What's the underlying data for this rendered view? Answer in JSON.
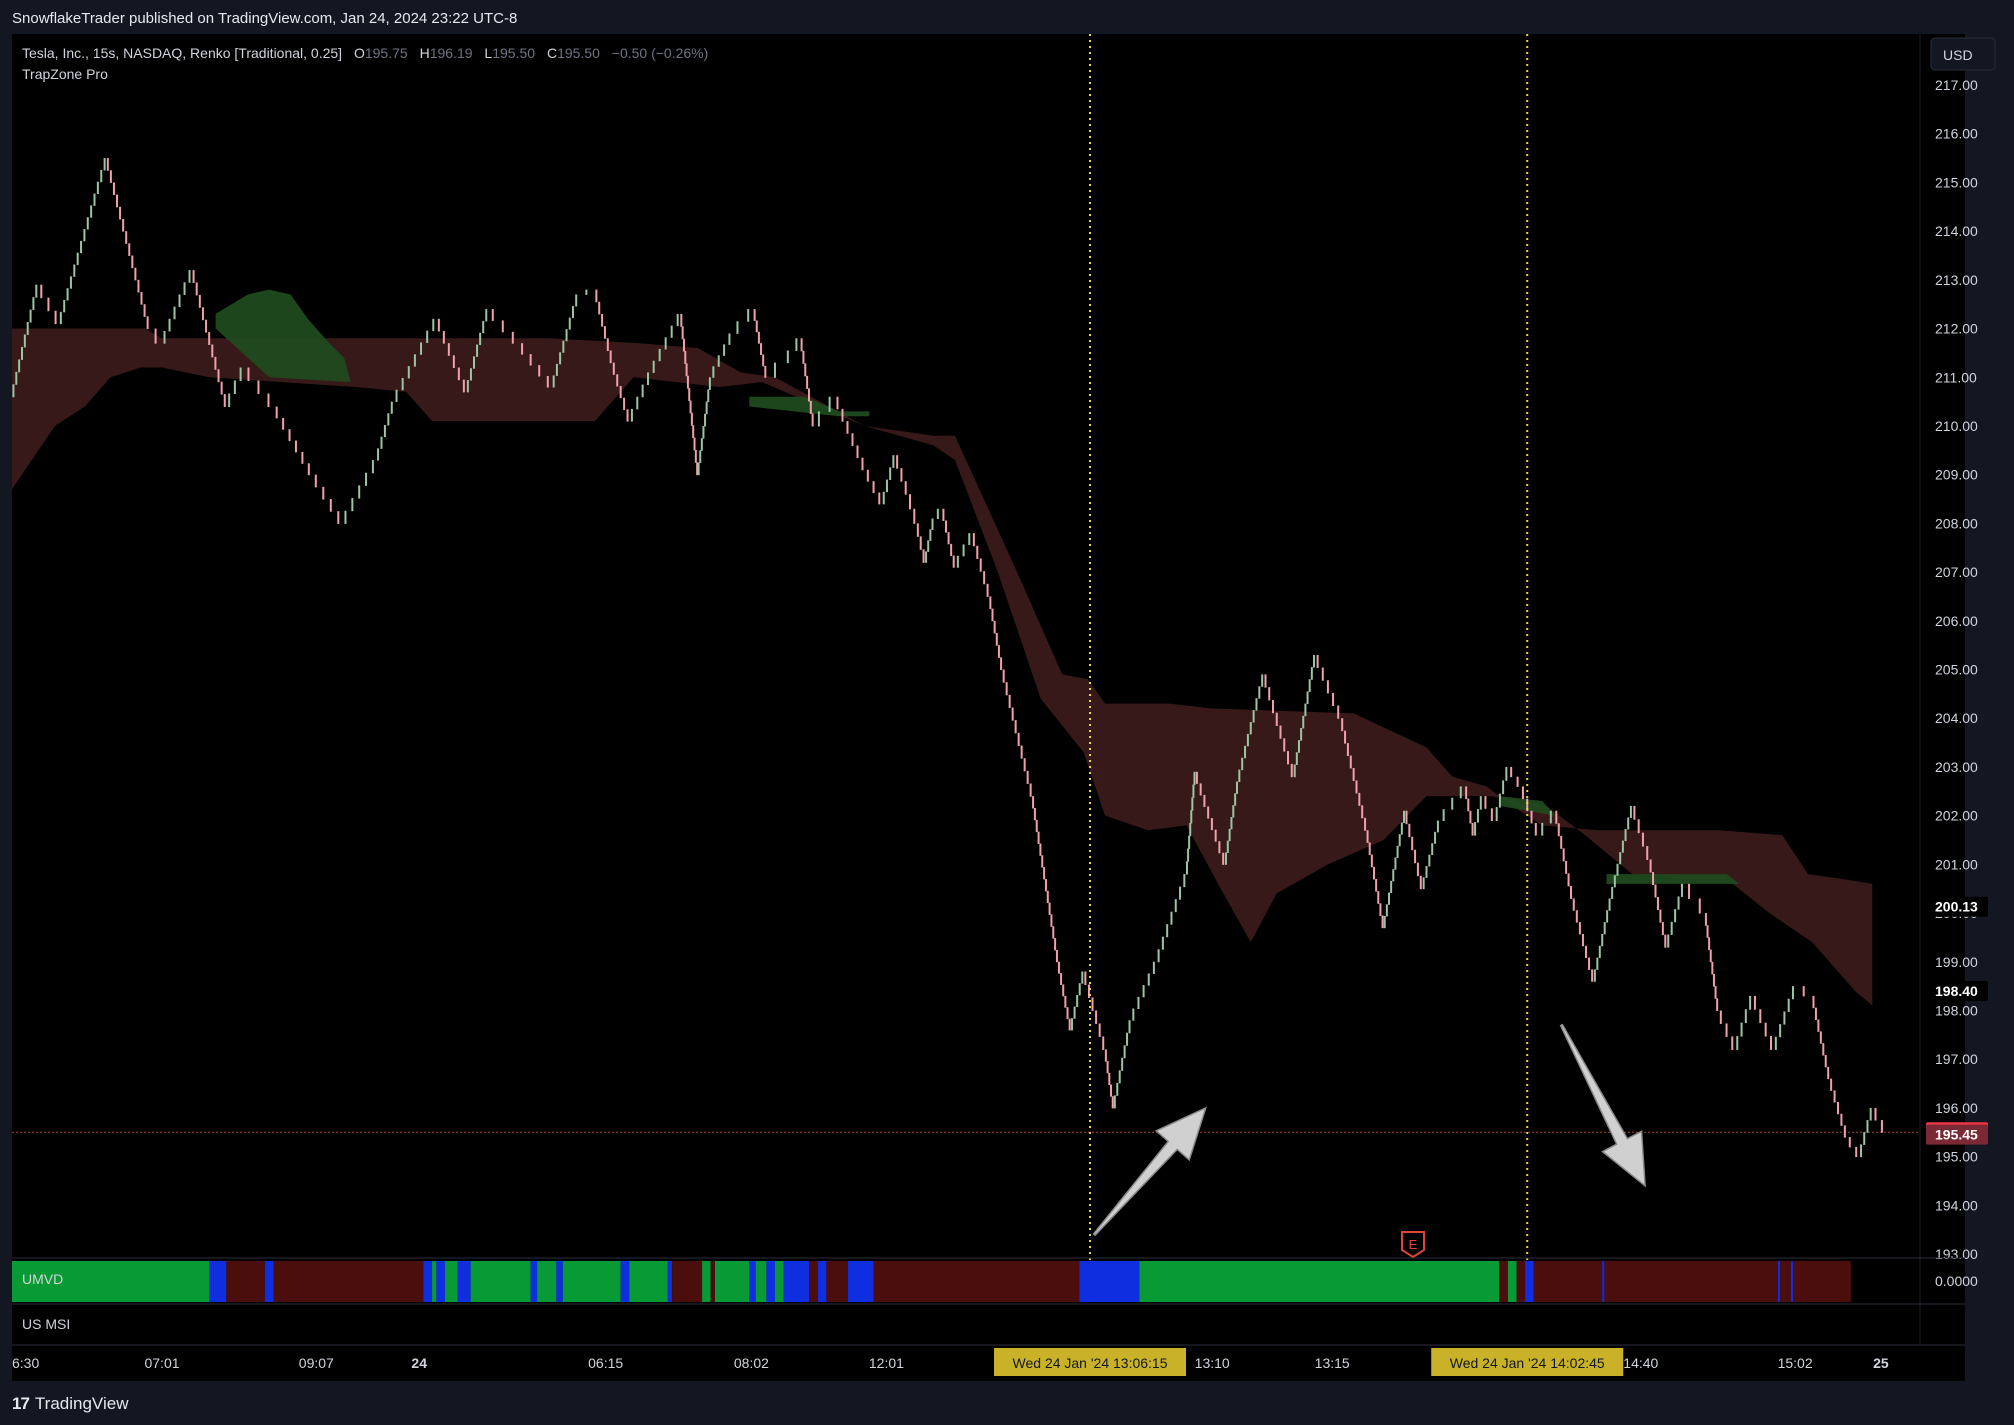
{
  "publisher": "SnowflakeTrader published on TradingView.com, Jan 24, 2024 23:22 UTC-8",
  "legend": {
    "symbol": "Tesla, Inc., 15s, NASDAQ, Renko [Traditional, 0.25]",
    "o_label": "O",
    "o_value": "195.75",
    "h_label": "H",
    "h_value": "196.19",
    "l_label": "L",
    "l_value": "195.50",
    "c_label": "C",
    "c_value": "195.50",
    "change": "−0.50 (−0.26%)",
    "indicator": "TrapZone Pro"
  },
  "currency_button": "USD",
  "pane1_label": "UMVD",
  "pane1_value": "0.0000",
  "pane2_label": "US MSI",
  "earnings_marker": "E",
  "footer_logo": "TradingView",
  "colors": {
    "up": "#9bc5a5",
    "down": "#f2a0ac",
    "zone_red": "#3b1a1a",
    "zone_green": "#1f4a1f",
    "umvd_green": "#089a34",
    "umvd_red": "#4c0d0d",
    "umvd_blue": "#0f2ee0",
    "price_tag": "#f23645",
    "price_tag2": "#7b2a35",
    "crosshair": "#e8d84a"
  },
  "chart_data": {
    "type": "line",
    "title": "Tesla, Inc., 15s, NASDAQ, Renko [Traditional, 0.25]",
    "ylim": [
      192.9,
      217.5
    ],
    "y_ticks": [
      193.0,
      194.0,
      195.0,
      196.0,
      197.0,
      198.0,
      199.0,
      200.0,
      201.0,
      202.0,
      203.0,
      204.0,
      205.0,
      206.0,
      207.0,
      208.0,
      209.0,
      210.0,
      211.0,
      212.0,
      213.0,
      214.0,
      215.0,
      216.0,
      217.0
    ],
    "y_tick_labels": [
      "193.00",
      "194.00",
      "195.00",
      "196.00",
      "197.00",
      "198.00",
      "199.00",
      "200.00",
      "201.00",
      "202.00",
      "203.00",
      "204.00",
      "205.00",
      "206.00",
      "207.00",
      "208.00",
      "209.00",
      "210.00",
      "211.00",
      "212.00",
      "213.00",
      "214.00",
      "215.00",
      "216.00",
      "217.00"
    ],
    "x_ticks": [
      {
        "label": "6:30",
        "i": 0
      },
      {
        "label": "07:01",
        "i": 70
      },
      {
        "label": "09:07",
        "i": 142
      },
      {
        "label": "24",
        "i": 190
      },
      {
        "label": "06:15",
        "i": 277
      },
      {
        "label": "08:02",
        "i": 345
      },
      {
        "label": "12:01",
        "i": 408
      },
      {
        "label": "13:10",
        "i": 560
      },
      {
        "label": "13:15",
        "i": 616
      },
      {
        "label": "14:40",
        "i": 760
      },
      {
        "label": "15:02",
        "i": 832
      },
      {
        "label": "25",
        "i": 872
      }
    ],
    "x_count": 880,
    "crosshair_labels": [
      {
        "label": "Wed 24 Jan '24   13:06:15",
        "i": 503
      },
      {
        "label": "Wed 24 Jan '24   14:02:45",
        "i": 707
      }
    ],
    "price_labels": [
      {
        "label": "200.13",
        "value": 200.13,
        "style": "plain"
      },
      {
        "label": "198.40",
        "value": 198.4,
        "style": "plain"
      },
      {
        "label": "195.50",
        "value": 195.5,
        "style": "last"
      },
      {
        "label": "195.45",
        "value": 195.45,
        "style": "dark"
      }
    ],
    "last_price_line": 195.5,
    "series": [
      {
        "path": [
          [
            0,
            210.6
          ],
          [
            12,
            212.9
          ],
          [
            22,
            212.1
          ],
          [
            44,
            215.5
          ],
          [
            64,
            212.0
          ],
          [
            70,
            211.7
          ],
          [
            84,
            213.2
          ],
          [
            100,
            210.4
          ],
          [
            108,
            211.2
          ],
          [
            122,
            210.4
          ],
          [
            140,
            209.0
          ],
          [
            154,
            208.0
          ],
          [
            170,
            209.3
          ],
          [
            178,
            210.5
          ],
          [
            198,
            212.2
          ],
          [
            212,
            210.7
          ],
          [
            222,
            212.4
          ],
          [
            236,
            211.7
          ],
          [
            252,
            210.8
          ],
          [
            264,
            212.7
          ],
          [
            272,
            212.8
          ],
          [
            280,
            211.3
          ],
          [
            288,
            210.1
          ],
          [
            298,
            211.1
          ],
          [
            312,
            212.3
          ],
          [
            320,
            209.0
          ],
          [
            326,
            211.0
          ],
          [
            336,
            211.9
          ],
          [
            346,
            212.4
          ],
          [
            352,
            211.0
          ],
          [
            360,
            211.3
          ],
          [
            368,
            211.8
          ],
          [
            374,
            210.0
          ],
          [
            384,
            210.6
          ],
          [
            398,
            209.1
          ],
          [
            406,
            208.4
          ],
          [
            412,
            209.4
          ],
          [
            418,
            208.6
          ],
          [
            422,
            208.0
          ],
          [
            426,
            207.2
          ],
          [
            430,
            208.1
          ],
          [
            434,
            208.3
          ],
          [
            440,
            207.1
          ],
          [
            448,
            207.8
          ],
          [
            456,
            206.5
          ],
          [
            462,
            205.0
          ],
          [
            476,
            202.4
          ],
          [
            488,
            199.0
          ],
          [
            494,
            197.6
          ],
          [
            500,
            198.8
          ],
          [
            510,
            197.2
          ],
          [
            514,
            196.0
          ],
          [
            522,
            197.8
          ],
          [
            534,
            199.0
          ],
          [
            548,
            200.8
          ],
          [
            552,
            202.9
          ],
          [
            566,
            201.0
          ],
          [
            572,
            202.7
          ],
          [
            584,
            204.9
          ],
          [
            598,
            202.8
          ],
          [
            608,
            205.3
          ],
          [
            620,
            204.0
          ],
          [
            632,
            201.7
          ],
          [
            640,
            199.7
          ],
          [
            650,
            202.1
          ],
          [
            658,
            200.5
          ],
          [
            666,
            201.9
          ],
          [
            678,
            202.6
          ],
          [
            682,
            201.6
          ],
          [
            686,
            202.4
          ],
          [
            692,
            201.9
          ],
          [
            698,
            203.0
          ],
          [
            704,
            202.6
          ],
          [
            712,
            201.6
          ],
          [
            720,
            202.1
          ],
          [
            728,
            200.3
          ],
          [
            738,
            198.6
          ],
          [
            746,
            200.3
          ],
          [
            756,
            202.2
          ],
          [
            764,
            201.1
          ],
          [
            772,
            199.3
          ],
          [
            780,
            200.6
          ],
          [
            790,
            200.0
          ],
          [
            796,
            198.0
          ],
          [
            804,
            197.2
          ],
          [
            812,
            198.3
          ],
          [
            822,
            197.2
          ],
          [
            832,
            198.5
          ],
          [
            840,
            198.3
          ],
          [
            848,
            196.6
          ],
          [
            856,
            195.4
          ],
          [
            862,
            195.0
          ],
          [
            868,
            196.0
          ],
          [
            874,
            195.5
          ]
        ]
      }
    ],
    "zones": [
      {
        "color": "red",
        "top": [
          [
            0,
            212.0
          ],
          [
            62,
            212.0
          ],
          [
            70,
            211.8
          ],
          [
            250,
            211.8
          ],
          [
            292,
            211.7
          ],
          [
            320,
            211.6
          ],
          [
            340,
            211.1
          ],
          [
            356,
            211.0
          ],
          [
            398,
            210.0
          ],
          [
            430,
            209.8
          ],
          [
            440,
            209.8
          ],
          [
            470,
            206.9
          ],
          [
            490,
            204.9
          ],
          [
            502,
            204.8
          ],
          [
            510,
            204.3
          ],
          [
            540,
            204.3
          ],
          [
            560,
            204.2
          ],
          [
            626,
            204.1
          ],
          [
            660,
            203.4
          ],
          [
            672,
            202.8
          ],
          [
            688,
            202.6
          ],
          [
            700,
            202.2
          ],
          [
            714,
            201.8
          ],
          [
            740,
            201.7
          ],
          [
            768,
            201.7
          ],
          [
            796,
            201.7
          ],
          [
            826,
            201.6
          ],
          [
            838,
            200.8
          ],
          [
            854,
            200.7
          ],
          [
            868,
            200.6
          ]
        ],
        "bottom": [
          [
            0,
            208.7
          ],
          [
            20,
            210.0
          ],
          [
            34,
            210.4
          ],
          [
            46,
            211.0
          ],
          [
            60,
            211.2
          ],
          [
            70,
            211.2
          ],
          [
            92,
            211.0
          ],
          [
            160,
            210.8
          ],
          [
            184,
            210.7
          ],
          [
            196,
            210.1
          ],
          [
            236,
            210.1
          ],
          [
            272,
            210.1
          ],
          [
            290,
            211.0
          ],
          [
            330,
            210.8
          ],
          [
            350,
            210.9
          ],
          [
            398,
            210.0
          ],
          [
            430,
            209.6
          ],
          [
            440,
            209.3
          ],
          [
            460,
            207.0
          ],
          [
            480,
            204.4
          ],
          [
            500,
            203.3
          ],
          [
            510,
            202.0
          ],
          [
            530,
            201.7
          ],
          [
            548,
            201.8
          ],
          [
            564,
            200.5
          ],
          [
            578,
            199.4
          ],
          [
            590,
            200.4
          ],
          [
            614,
            201.0
          ],
          [
            640,
            201.5
          ],
          [
            660,
            202.4
          ],
          [
            690,
            202.4
          ],
          [
            716,
            202.2
          ],
          [
            734,
            201.6
          ],
          [
            756,
            200.8
          ],
          [
            780,
            200.7
          ],
          [
            800,
            200.7
          ],
          [
            820,
            200.0
          ],
          [
            840,
            199.4
          ],
          [
            860,
            198.4
          ],
          [
            868,
            198.1
          ]
        ]
      },
      {
        "color": "green",
        "top": [
          [
            95,
            212.3
          ],
          [
            110,
            212.7
          ],
          [
            120,
            212.8
          ],
          [
            130,
            212.7
          ],
          [
            138,
            212.2
          ],
          [
            148,
            211.7
          ],
          [
            155,
            211.4
          ],
          [
            158,
            210.9
          ]
        ],
        "bottom": [
          [
            95,
            212.0
          ],
          [
            120,
            211.0
          ],
          [
            158,
            210.9
          ]
        ]
      },
      {
        "color": "green",
        "top": [
          [
            344,
            210.6
          ],
          [
            370,
            210.6
          ],
          [
            386,
            210.3
          ],
          [
            400,
            210.3
          ]
        ],
        "bottom": [
          [
            344,
            210.4
          ],
          [
            386,
            210.2
          ],
          [
            400,
            210.2
          ]
        ]
      },
      {
        "color": "green",
        "top": [
          [
            694,
            202.4
          ],
          [
            714,
            202.3
          ],
          [
            720,
            202.0
          ]
        ],
        "bottom": [
          [
            694,
            202.2
          ],
          [
            720,
            202.0
          ]
        ]
      },
      {
        "color": "green",
        "top": [
          [
            744,
            200.8
          ],
          [
            770,
            200.8
          ],
          [
            800,
            200.8
          ],
          [
            806,
            200.6
          ]
        ],
        "bottom": [
          [
            744,
            200.6
          ],
          [
            806,
            200.6
          ]
        ]
      }
    ],
    "umvd_segments": [
      {
        "from": 0,
        "to": 92,
        "color": "green"
      },
      {
        "from": 92,
        "to": 100,
        "color": "blue"
      },
      {
        "from": 100,
        "to": 118,
        "color": "red"
      },
      {
        "from": 118,
        "to": 122,
        "color": "blue"
      },
      {
        "from": 122,
        "to": 192,
        "color": "red"
      },
      {
        "from": 192,
        "to": 196,
        "color": "blue"
      },
      {
        "from": 196,
        "to": 198,
        "color": "green"
      },
      {
        "from": 198,
        "to": 202,
        "color": "blue"
      },
      {
        "from": 202,
        "to": 208,
        "color": "green"
      },
      {
        "from": 208,
        "to": 214,
        "color": "blue"
      },
      {
        "from": 214,
        "to": 242,
        "color": "green"
      },
      {
        "from": 242,
        "to": 245,
        "color": "blue"
      },
      {
        "from": 245,
        "to": 254,
        "color": "green"
      },
      {
        "from": 254,
        "to": 257,
        "color": "blue"
      },
      {
        "from": 257,
        "to": 284,
        "color": "green"
      },
      {
        "from": 284,
        "to": 288,
        "color": "blue"
      },
      {
        "from": 288,
        "to": 306,
        "color": "green"
      },
      {
        "from": 306,
        "to": 308,
        "color": "blue"
      },
      {
        "from": 308,
        "to": 322,
        "color": "red"
      },
      {
        "from": 322,
        "to": 326,
        "color": "green"
      },
      {
        "from": 326,
        "to": 328,
        "color": "red"
      },
      {
        "from": 328,
        "to": 344,
        "color": "green"
      },
      {
        "from": 344,
        "to": 347,
        "color": "blue"
      },
      {
        "from": 347,
        "to": 352,
        "color": "green"
      },
      {
        "from": 352,
        "to": 356,
        "color": "blue"
      },
      {
        "from": 356,
        "to": 360,
        "color": "green"
      },
      {
        "from": 360,
        "to": 372,
        "color": "blue"
      },
      {
        "from": 372,
        "to": 376,
        "color": "red"
      },
      {
        "from": 376,
        "to": 380,
        "color": "blue"
      },
      {
        "from": 380,
        "to": 390,
        "color": "red"
      },
      {
        "from": 390,
        "to": 402,
        "color": "blue"
      },
      {
        "from": 402,
        "to": 498,
        "color": "red"
      },
      {
        "from": 498,
        "to": 526,
        "color": "blue"
      },
      {
        "from": 526,
        "to": 694,
        "color": "green"
      },
      {
        "from": 694,
        "to": 698,
        "color": "red"
      },
      {
        "from": 698,
        "to": 702,
        "color": "green"
      },
      {
        "from": 702,
        "to": 706,
        "color": "red"
      },
      {
        "from": 706,
        "to": 710,
        "color": "blue"
      },
      {
        "from": 710,
        "to": 742,
        "color": "red"
      },
      {
        "from": 742,
        "to": 743,
        "color": "blue"
      },
      {
        "from": 743,
        "to": 824,
        "color": "red"
      },
      {
        "from": 824,
        "to": 825,
        "color": "blue"
      },
      {
        "from": 825,
        "to": 830,
        "color": "red"
      },
      {
        "from": 830,
        "to": 831,
        "color": "blue"
      },
      {
        "from": 831,
        "to": 858,
        "color": "red"
      }
    ],
    "arrows": [
      {
        "from": [
          505,
          193.4
        ],
        "to": [
          557,
          196.0
        ]
      },
      {
        "from": [
          723,
          197.7
        ],
        "to": [
          762,
          194.4
        ]
      }
    ],
    "grid": false
  }
}
